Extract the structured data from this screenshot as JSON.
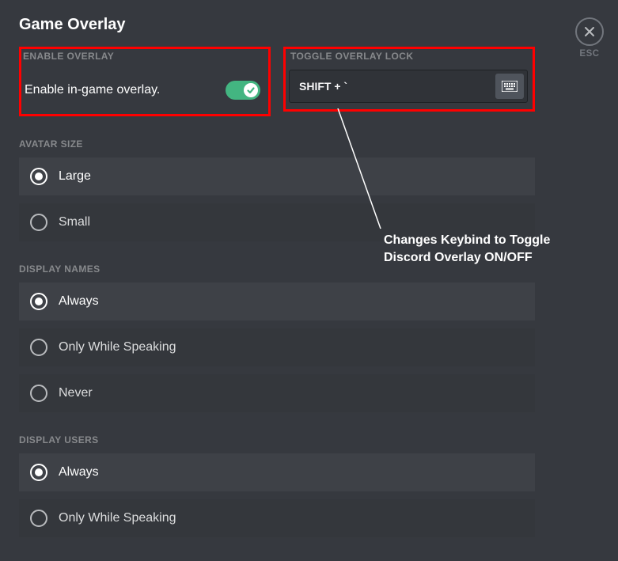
{
  "page": {
    "title": "Game Overlay"
  },
  "esc": {
    "label": "ESC"
  },
  "enable": {
    "heading": "ENABLE OVERLAY",
    "label": "Enable in-game overlay."
  },
  "toggleLock": {
    "heading": "TOGGLE OVERLAY LOCK",
    "value": "SHIFT + `"
  },
  "avatarSize": {
    "heading": "AVATAR SIZE",
    "options": [
      {
        "label": "Large",
        "selected": true
      },
      {
        "label": "Small",
        "selected": false
      }
    ]
  },
  "displayNames": {
    "heading": "DISPLAY NAMES",
    "options": [
      {
        "label": "Always",
        "selected": true
      },
      {
        "label": "Only While Speaking",
        "selected": false
      },
      {
        "label": "Never",
        "selected": false
      }
    ]
  },
  "displayUsers": {
    "heading": "DISPLAY USERS",
    "options": [
      {
        "label": "Always",
        "selected": true
      },
      {
        "label": "Only While Speaking",
        "selected": false
      }
    ]
  },
  "annotation": {
    "line1": "Changes Keybind to Toggle",
    "line2": "Discord Overlay ON/OFF"
  }
}
